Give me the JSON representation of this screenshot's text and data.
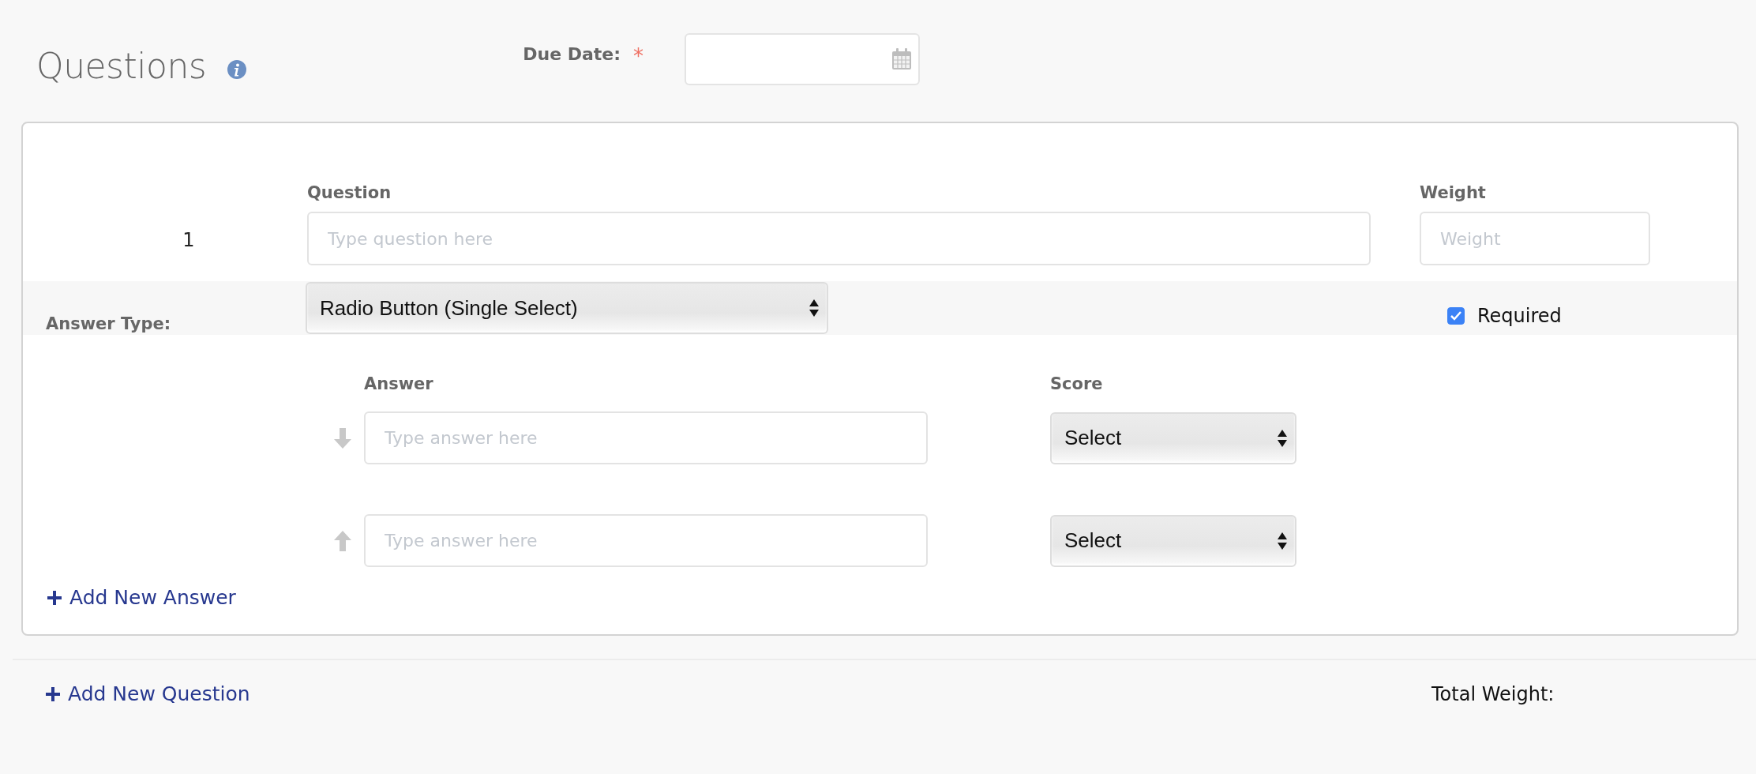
{
  "header": {
    "title": "Questions",
    "due_date": {
      "label": "Due Date:",
      "required_mark": "*"
    }
  },
  "questions": [
    {
      "number": "1",
      "question_label": "Question",
      "question_placeholder": "Type question here",
      "weight_label": "Weight",
      "weight_placeholder": "Weight",
      "answer_type_label": "Answer Type:",
      "answer_type": "Radio Button (Single Select)",
      "required": {
        "label": "Required",
        "checked": true
      },
      "answer_label": "Answer",
      "score_label": "Score",
      "answers": [
        {
          "kind": "down",
          "placeholder": "Type answer here",
          "score": "Select"
        },
        {
          "kind": "up",
          "placeholder": "Type answer here",
          "score": "Select"
        }
      ],
      "add_answer": "Add New Answer"
    }
  ],
  "footer": {
    "add_question": "Add New Question",
    "total_weight_label": "Total Weight:"
  }
}
